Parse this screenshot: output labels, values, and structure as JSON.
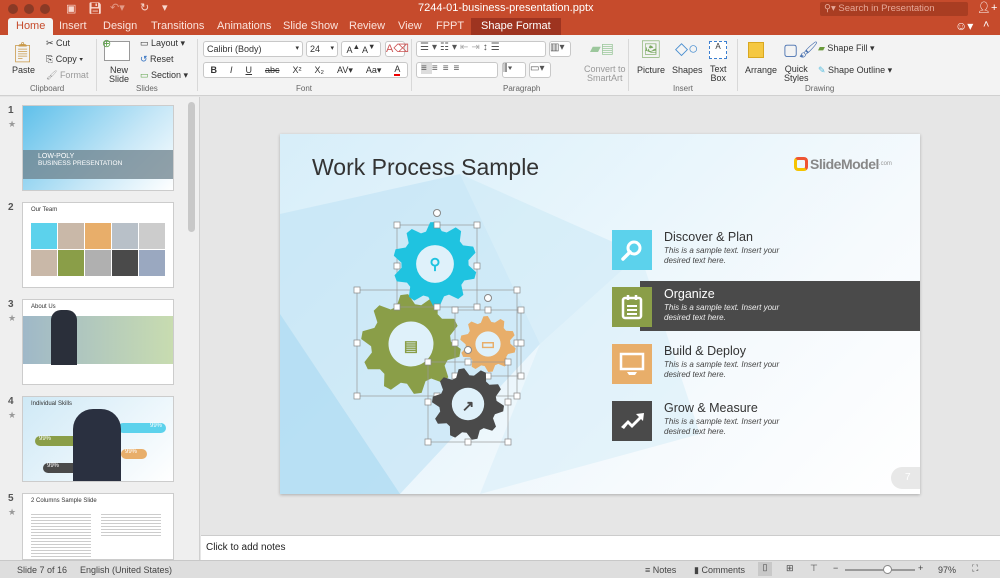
{
  "window": {
    "title": "7244-01-business-presentation.pptx",
    "search_placeholder": "Search in Presentation"
  },
  "tabs": [
    {
      "label": "Home",
      "active": true
    },
    {
      "label": "Insert"
    },
    {
      "label": "Design"
    },
    {
      "label": "Transitions"
    },
    {
      "label": "Animations"
    },
    {
      "label": "Slide Show"
    },
    {
      "label": "Review"
    },
    {
      "label": "View"
    },
    {
      "label": "FPPT"
    },
    {
      "label": "Shape Format"
    }
  ],
  "ribbon": {
    "clipboard": {
      "paste": "Paste",
      "cut": "Cut",
      "copy": "Copy",
      "format": "Format",
      "group": "Clipboard"
    },
    "slides": {
      "new_slide_1": "New",
      "new_slide_2": "Slide",
      "layout": "Layout",
      "reset": "Reset",
      "section": "Section",
      "group": "Slides"
    },
    "font": {
      "font_name": "Calibri (Body)",
      "font_size": "24",
      "bold": "B",
      "italic": "I",
      "underline": "U",
      "strike": "abc",
      "group": "Font"
    },
    "paragraph": {
      "convert_1": "Convert to",
      "convert_2": "SmartArt",
      "group": "Paragraph"
    },
    "insert": {
      "picture": "Picture",
      "shapes": "Shapes",
      "textbox_1": "Text",
      "textbox_2": "Box",
      "group": "Insert"
    },
    "drawing": {
      "arrange": "Arrange",
      "quick_1": "Quick",
      "quick_2": "Styles",
      "shape_fill": "Shape Fill",
      "shape_outline": "Shape Outline",
      "group": "Drawing"
    }
  },
  "thumbnails": [
    {
      "num": "1",
      "title": "LOW-POLY",
      "subtitle": "BUSINESS PRESENTATION",
      "starred": true
    },
    {
      "num": "2",
      "title": "Our Team",
      "starred": false
    },
    {
      "num": "3",
      "title": "About Us",
      "starred": true
    },
    {
      "num": "4",
      "title": "Individual Skills",
      "pct": "99%",
      "starred": true
    },
    {
      "num": "5",
      "title": "2 Columns Sample Slide",
      "starred": true
    }
  ],
  "slide": {
    "title": "Work Process Sample",
    "logo": "SlideModel.com",
    "page_number": "7",
    "items": [
      {
        "title": "Discover & Plan",
        "desc1": "This is a sample text. Insert your",
        "desc2": "desired text here.",
        "color": "#5cd2ec",
        "icon": "magnifier-icon"
      },
      {
        "title": "Organize",
        "desc1": "This is a sample text. Insert your",
        "desc2": "desired text here.",
        "color": "#8a9e48",
        "icon": "clipboard-icon",
        "highlighted": true
      },
      {
        "title": "Build & Deploy",
        "desc1": "This is a sample text. Insert your",
        "desc2": "desired text here.",
        "color": "#e8ae6a",
        "icon": "monitor-icon"
      },
      {
        "title": "Grow & Measure",
        "desc1": "This is a sample text. Insert your",
        "desc2": "desired text here.",
        "color": "#4a4a4a",
        "icon": "trend-arrow-icon"
      }
    ],
    "gear_colors": {
      "blue": "#1fc3e0",
      "green": "#8a9e48",
      "orange": "#e8ae6a",
      "dark": "#4a4a4a"
    }
  },
  "notes_placeholder": "Click to add notes",
  "status": {
    "slide": "Slide 7 of 16",
    "language": "English (United States)",
    "notes": "Notes",
    "comments": "Comments",
    "zoom": "97%",
    "zoom_level": 0.6
  }
}
